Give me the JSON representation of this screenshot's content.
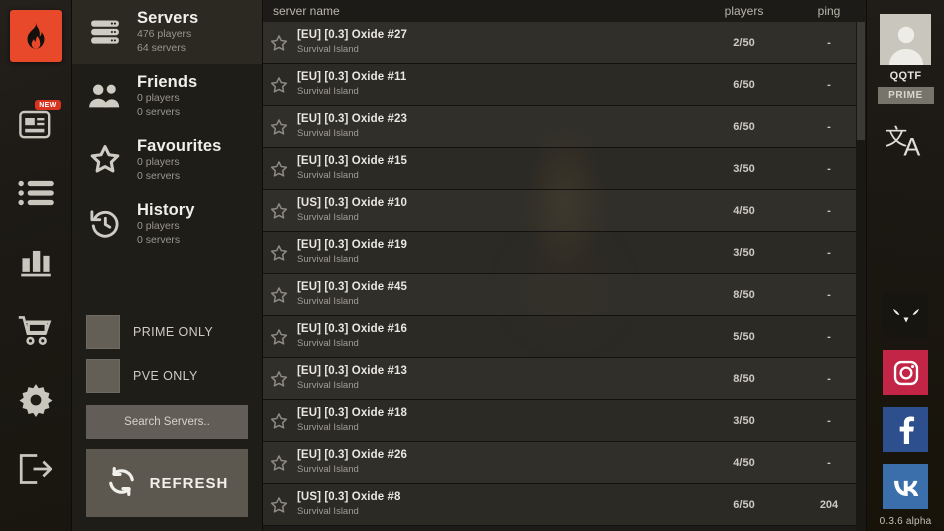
{
  "rail": {
    "logo_icon": "flame-logo-icon",
    "items": [
      {
        "icon": "news-icon",
        "badge": "NEW"
      },
      {
        "icon": "server-list-icon",
        "badge": ""
      },
      {
        "icon": "stats-bar-chart-icon",
        "badge": ""
      },
      {
        "icon": "shopping-cart-icon",
        "badge": ""
      },
      {
        "icon": "settings-gear-icon",
        "badge": ""
      },
      {
        "icon": "exit-logout-icon",
        "badge": ""
      }
    ]
  },
  "sidebar": {
    "categories": [
      {
        "title": "Servers",
        "players": "476 players",
        "servers": "64 servers",
        "icon": "servers-rack-icon",
        "active": true
      },
      {
        "title": "Friends",
        "players": "0 players",
        "servers": "0 servers",
        "icon": "friends-people-icon",
        "active": false
      },
      {
        "title": "Favourites",
        "players": "0 players",
        "servers": "0 servers",
        "icon": "favourites-star-icon",
        "active": false
      },
      {
        "title": "History",
        "players": "0 players",
        "servers": "0 servers",
        "icon": "history-clock-icon",
        "active": false
      }
    ],
    "filters": [
      {
        "label": "PRIME ONLY",
        "checked": false
      },
      {
        "label": "PVE ONLY",
        "checked": false
      }
    ],
    "search_placeholder": "Search Servers..",
    "search_value": "",
    "refresh_label": "REFRESH",
    "refresh_icon": "refresh-circular-arrows-icon"
  },
  "list": {
    "columns": {
      "name": "server name",
      "players": "players",
      "ping": "ping"
    },
    "rows": [
      {
        "name": "[EU] [0.3] Oxide #27",
        "map": "Survival Island",
        "players": "2/50",
        "ping": "-"
      },
      {
        "name": "[EU] [0.3] Oxide #11",
        "map": "Survival Island",
        "players": "6/50",
        "ping": "-"
      },
      {
        "name": "[EU] [0.3] Oxide #23",
        "map": "Survival Island",
        "players": "6/50",
        "ping": "-"
      },
      {
        "name": "[EU] [0.3] Oxide #15",
        "map": "Survival Island",
        "players": "3/50",
        "ping": "-"
      },
      {
        "name": "[US] [0.3] Oxide #10",
        "map": "Survival Island",
        "players": "4/50",
        "ping": "-"
      },
      {
        "name": "[EU] [0.3] Oxide #19",
        "map": "Survival Island",
        "players": "3/50",
        "ping": "-"
      },
      {
        "name": "[EU] [0.3] Oxide #45",
        "map": "Survival Island",
        "players": "8/50",
        "ping": "-"
      },
      {
        "name": "[EU] [0.3] Oxide #16",
        "map": "Survival Island",
        "players": "5/50",
        "ping": "-"
      },
      {
        "name": "[EU] [0.3] Oxide #13",
        "map": "Survival Island",
        "players": "8/50",
        "ping": "-"
      },
      {
        "name": "[EU] [0.3] Oxide #18",
        "map": "Survival Island",
        "players": "3/50",
        "ping": "-"
      },
      {
        "name": "[EU] [0.3] Oxide #26",
        "map": "Survival Island",
        "players": "4/50",
        "ping": "-"
      },
      {
        "name": "[US] [0.3] Oxide #8",
        "map": "Survival Island",
        "players": "6/50",
        "ping": "204"
      }
    ]
  },
  "profile": {
    "username": "QQTF",
    "prime_label": "PRIME",
    "avatar_icon": "avatar-person-icon",
    "language_icon": "language-translate-icon"
  },
  "socials": [
    {
      "name": "twitter-bird-icon",
      "class": "twitter"
    },
    {
      "name": "instagram-icon",
      "class": "insta"
    },
    {
      "name": "facebook-icon",
      "class": "fb"
    },
    {
      "name": "vk-icon",
      "class": "vk"
    }
  ],
  "version": "0.3.6 alpha",
  "colors": {
    "accent": "#e8492b",
    "panel": "#1f1d18",
    "row": "#36342e",
    "prime": "#77746c"
  }
}
